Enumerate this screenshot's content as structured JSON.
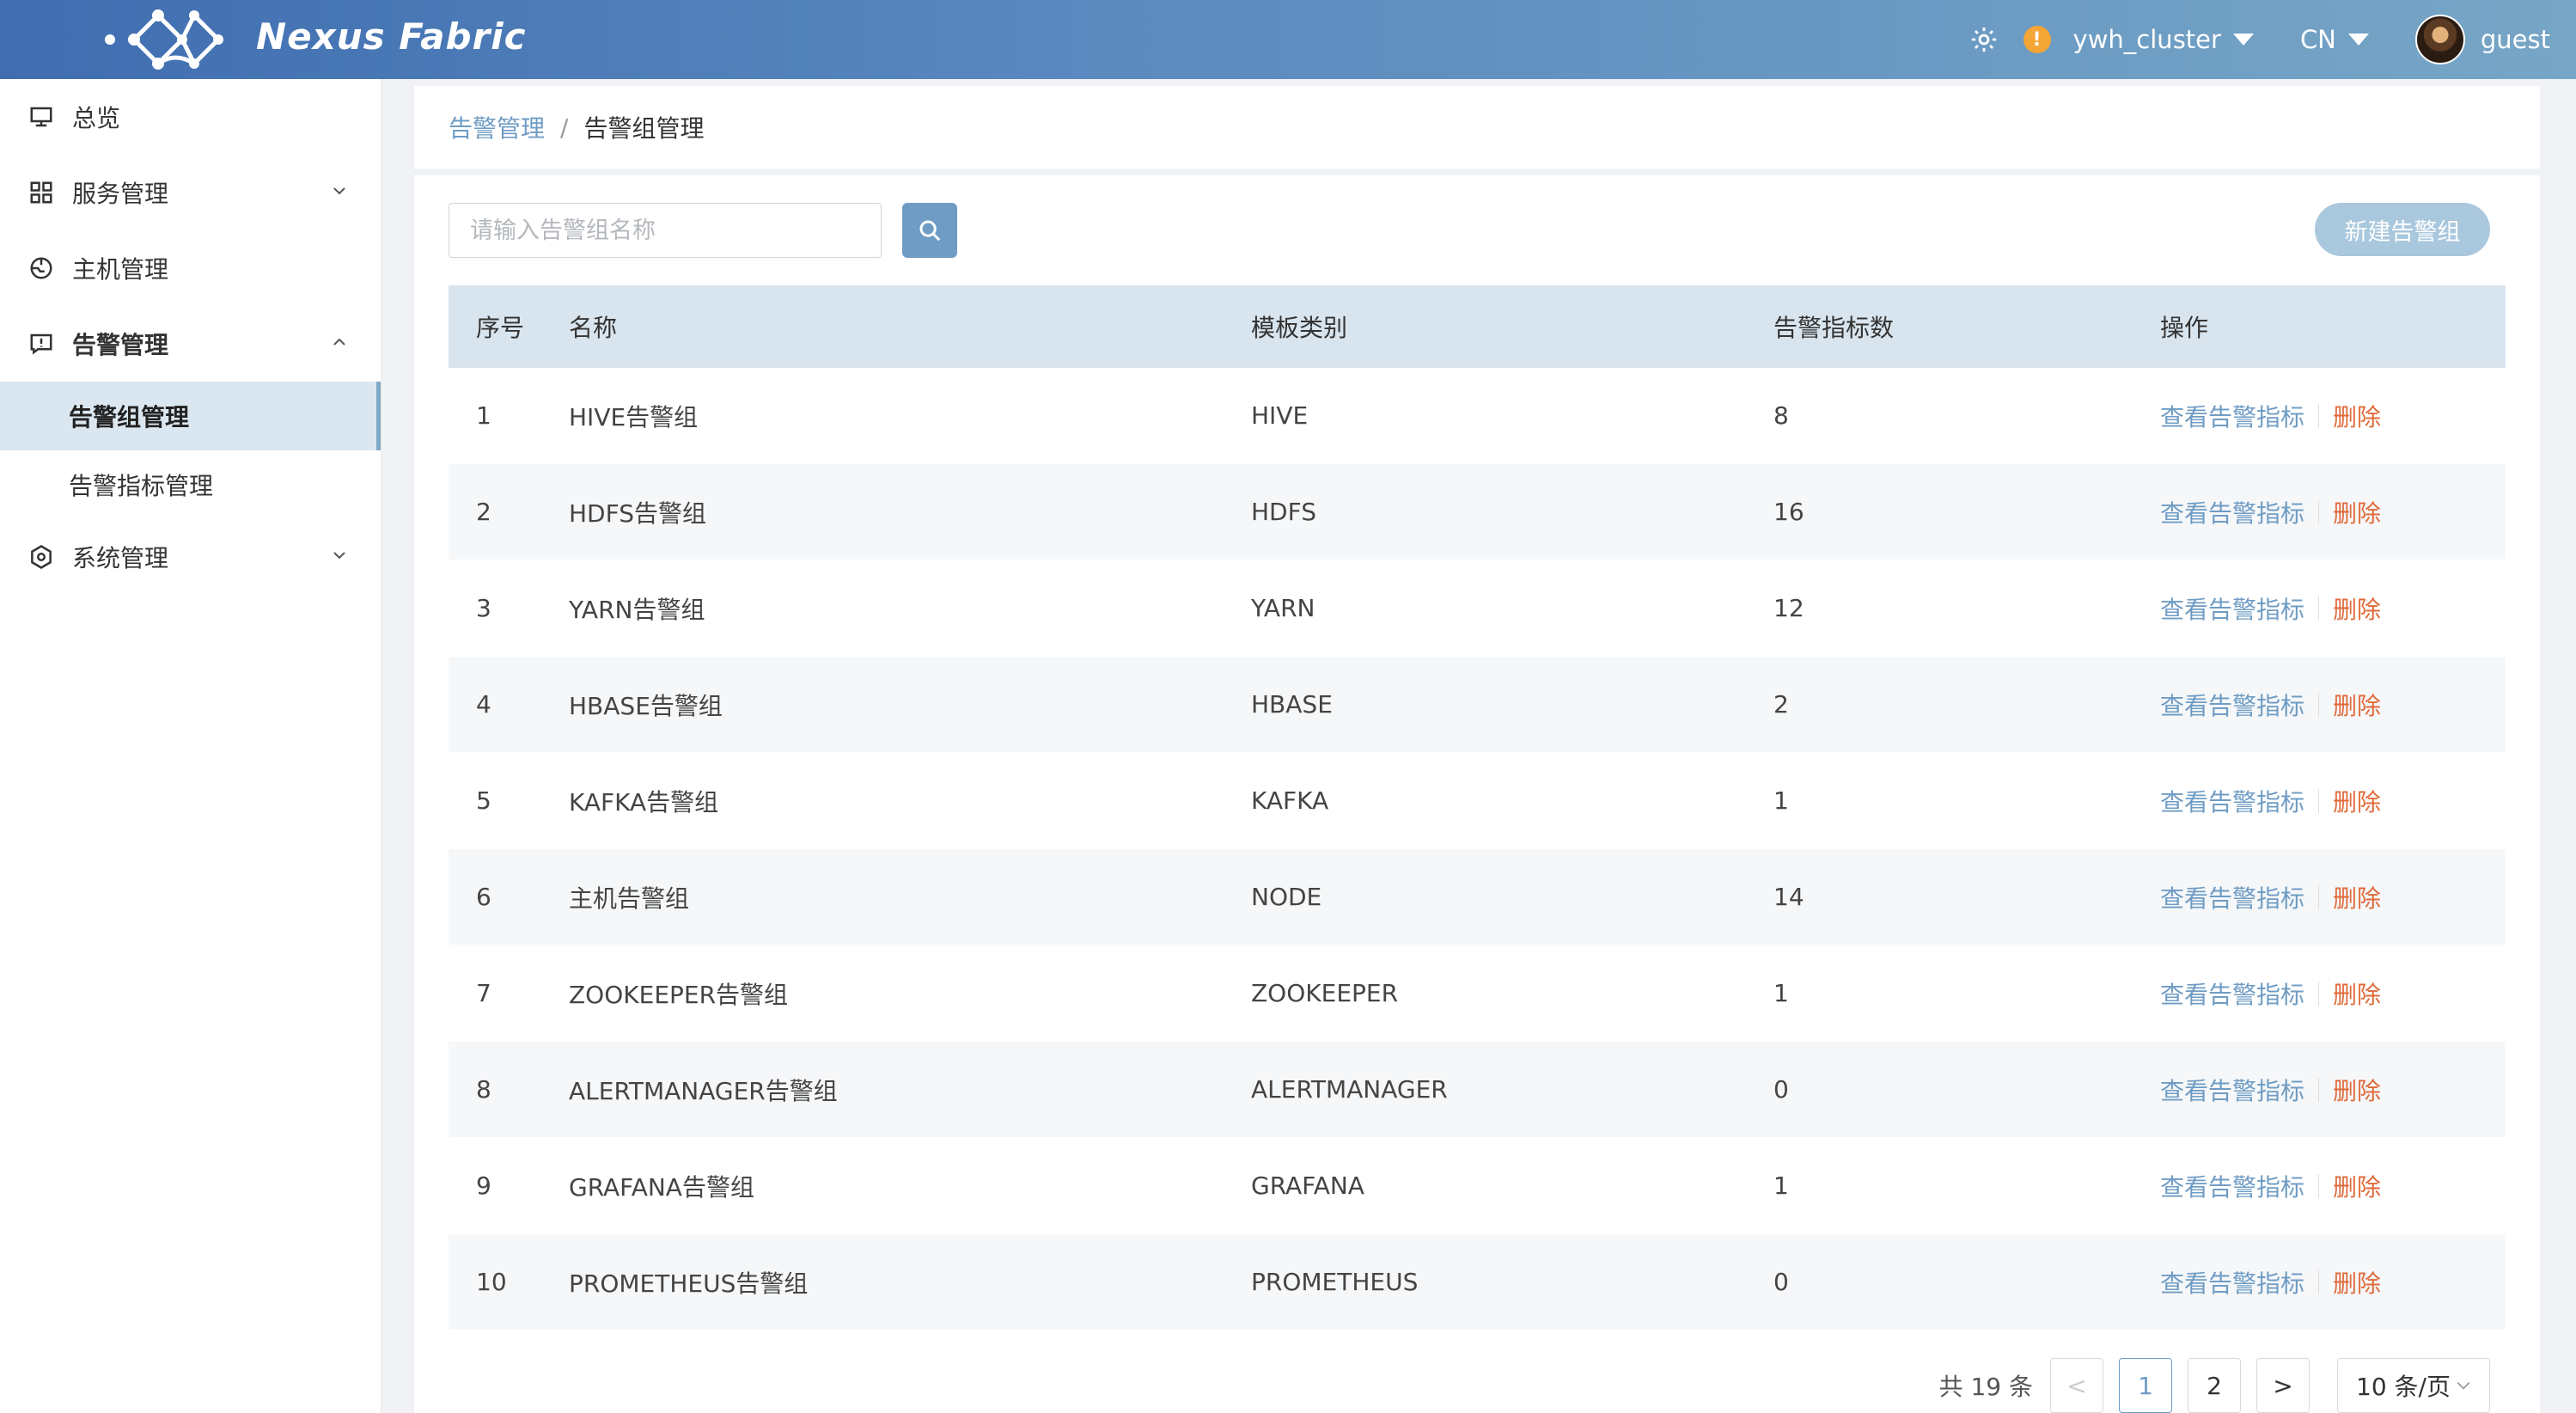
{
  "header": {
    "brand": "Nexus Fabric",
    "cluster": "ywh_cluster",
    "language": "CN",
    "user": "guest",
    "accent": "#6f9cc4",
    "warn_color": "#f3a536"
  },
  "sidebar": {
    "items": [
      {
        "label": "总览",
        "icon": "monitor-icon"
      },
      {
        "label": "服务管理",
        "icon": "grid-icon",
        "expandable": true
      },
      {
        "label": "主机管理",
        "icon": "host-icon"
      },
      {
        "label": "告警管理",
        "icon": "alert-icon",
        "expandable": true,
        "expanded": true,
        "children": [
          {
            "label": "告警组管理",
            "active": true
          },
          {
            "label": "告警指标管理"
          }
        ]
      },
      {
        "label": "系统管理",
        "icon": "settings-icon",
        "expandable": true
      }
    ]
  },
  "breadcrumb": {
    "parent": "告警管理",
    "separator": "/",
    "current": "告警组管理"
  },
  "toolbar": {
    "search_placeholder": "请输入告警组名称",
    "new_button": "新建告警组"
  },
  "table": {
    "headers": [
      "序号",
      "名称",
      "模板类别",
      "告警指标数",
      "操作"
    ],
    "rows": [
      {
        "no": "1",
        "name": "HIVE告警组",
        "template": "HIVE",
        "count": "8"
      },
      {
        "no": "2",
        "name": "HDFS告警组",
        "template": "HDFS",
        "count": "16"
      },
      {
        "no": "3",
        "name": "YARN告警组",
        "template": "YARN",
        "count": "12"
      },
      {
        "no": "4",
        "name": "HBASE告警组",
        "template": "HBASE",
        "count": "2"
      },
      {
        "no": "5",
        "name": "KAFKA告警组",
        "template": "KAFKA",
        "count": "1"
      },
      {
        "no": "6",
        "name": "主机告警组",
        "template": "NODE",
        "count": "14"
      },
      {
        "no": "7",
        "name": "ZOOKEEPER告警组",
        "template": "ZOOKEEPER",
        "count": "1"
      },
      {
        "no": "8",
        "name": "ALERTMANAGER告警组",
        "template": "ALERTMANAGER",
        "count": "0"
      },
      {
        "no": "9",
        "name": "GRAFANA告警组",
        "template": "GRAFANA",
        "count": "1"
      },
      {
        "no": "10",
        "name": "PROMETHEUS告警组",
        "template": "PROMETHEUS",
        "count": "0"
      }
    ],
    "action_view": "查看告警指标",
    "action_delete": "删除"
  },
  "pagination": {
    "total": "共 19 条",
    "prev": "<",
    "pages": [
      "1",
      "2"
    ],
    "current": "1",
    "next": ">",
    "page_size": "10 条/页"
  }
}
